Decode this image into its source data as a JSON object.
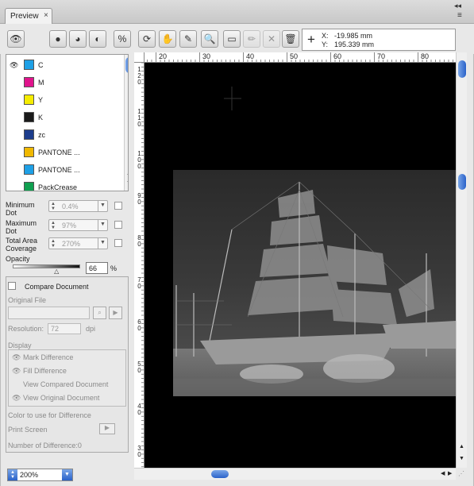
{
  "tab": {
    "title": "Preview",
    "close": "×"
  },
  "panel_controls": {
    "collapse": "◂◂",
    "menu": "≡"
  },
  "toolbar": {
    "tools": [
      {
        "icon": "eye-icon",
        "glyph": "👁"
      },
      {
        "icon": "separation-icon",
        "glyph": "●"
      },
      {
        "icon": "color-mode-icon",
        "glyph": "◕"
      },
      {
        "icon": "contrast-icon",
        "glyph": "◐"
      },
      {
        "icon": "tac-percent-icon",
        "glyph": "%"
      },
      {
        "icon": "rotate-icon",
        "glyph": "⟳"
      },
      {
        "icon": "hand-icon",
        "glyph": "✋"
      },
      {
        "icon": "eyedropper-icon",
        "glyph": "✎"
      },
      {
        "icon": "zoom-icon",
        "glyph": "🔍"
      },
      {
        "icon": "ruler-icon",
        "glyph": "▭"
      },
      {
        "icon": "pencil-icon",
        "glyph": "✏"
      },
      {
        "icon": "crop-icon",
        "glyph": "✕"
      },
      {
        "icon": "trash-icon",
        "glyph": "🗑"
      }
    ]
  },
  "coords": {
    "x_label": "X:",
    "x_value": "-19.985 mm",
    "y_label": "Y:",
    "y_value": "195.339 mm"
  },
  "inks": [
    {
      "name": "C",
      "color": "#1ea0e6",
      "visible": true
    },
    {
      "name": "M",
      "color": "#e0148c",
      "visible": false
    },
    {
      "name": "Y",
      "color": "#f5ec00",
      "visible": false
    },
    {
      "name": "K",
      "color": "#1a1a1a",
      "visible": false
    },
    {
      "name": "zc",
      "color": "#1c3c8c",
      "visible": false
    },
    {
      "name": "PANTONE ...",
      "color": "#f0b800",
      "visible": false
    },
    {
      "name": "PANTONE ...",
      "color": "#1ea0e6",
      "visible": false
    },
    {
      "name": "PackCrease",
      "color": "#10a050",
      "visible": false
    }
  ],
  "settings": {
    "min_dot_label": "Minimum Dot",
    "min_dot_value": "0.4%",
    "max_dot_label": "Maximum Dot",
    "max_dot_value": "97%",
    "tac_label": "Total Area Coverage",
    "tac_value": "270%"
  },
  "opacity": {
    "label": "Opacity",
    "value": "66",
    "unit": "%",
    "level": 0.66
  },
  "compare": {
    "checkbox_label": "Compare Document",
    "original_file_label": "Original File",
    "resolution_label": "Resolution:",
    "resolution_value": "72",
    "resolution_unit": "dpi",
    "display_label": "Display",
    "display_options": [
      "Mark Difference",
      "Fill Difference",
      "View Compared Document",
      "View Original Document"
    ],
    "color_label": "Color to use for Difference",
    "print_screen_label": "Print Screen",
    "num_diff_label": "Number of Difference:0"
  },
  "zoom": {
    "value": "200%"
  },
  "hruler": [
    "20",
    "30",
    "40",
    "50",
    "60",
    "70",
    "80"
  ],
  "vruler": [
    "1 2 0",
    "1 1 0",
    "1 0 0",
    "9 0",
    "8 0",
    "7 0",
    "6 0",
    "5 0",
    "4 0",
    "3 0"
  ]
}
